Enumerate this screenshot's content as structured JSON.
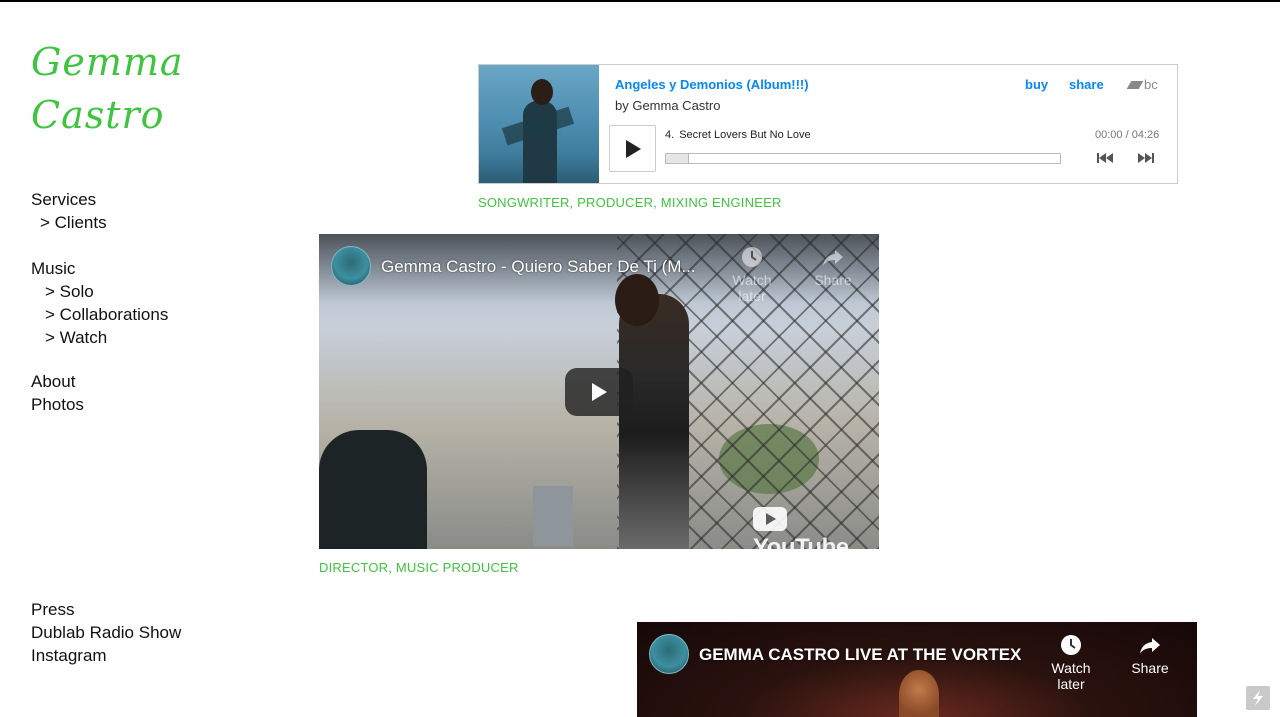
{
  "site": {
    "title_line1": "Gemma",
    "title_line2": "Castro",
    "title_color": "#3fc43f"
  },
  "nav": {
    "services": "Services",
    "clients": "> Clients",
    "music": "Music",
    "solo": "> Solo",
    "collaborations": "> Collaborations",
    "watch": "> Watch",
    "about": "About",
    "photos": "Photos",
    "press": "Press",
    "dublab": "Dublab Radio Show",
    "instagram": "Instagram"
  },
  "bandcamp": {
    "album_title": "Angeles y Demonios (Album!!!)",
    "artist": "by Gemma Castro",
    "buy": "buy",
    "share": "share",
    "logo": "bc",
    "track_number": "4.",
    "track_title": "Secret Lovers But No Love",
    "time": "00:00 / 04:26",
    "progress": 0,
    "link_color": "#0687f5"
  },
  "captions": {
    "first": "SONGWRITER, PRODUCER, MIXING ENGINEER",
    "second": "DIRECTOR, MUSIC PRODUCER"
  },
  "videos": [
    {
      "title": "Gemma Castro - Quiero Saber De Ti (M...",
      "watch_later": "Watch later",
      "share": "Share",
      "logo_text": "YouTube"
    },
    {
      "title": "GEMMA CASTRO LIVE AT THE VORTEX",
      "watch_later": "Watch later",
      "share": "Share"
    }
  ],
  "icons": {
    "play": "play-icon",
    "prev": "previous-track-icon",
    "next": "next-track-icon",
    "clock": "clock-icon",
    "share": "share-arrow-icon",
    "bolt": "lightning-bolt-icon"
  }
}
